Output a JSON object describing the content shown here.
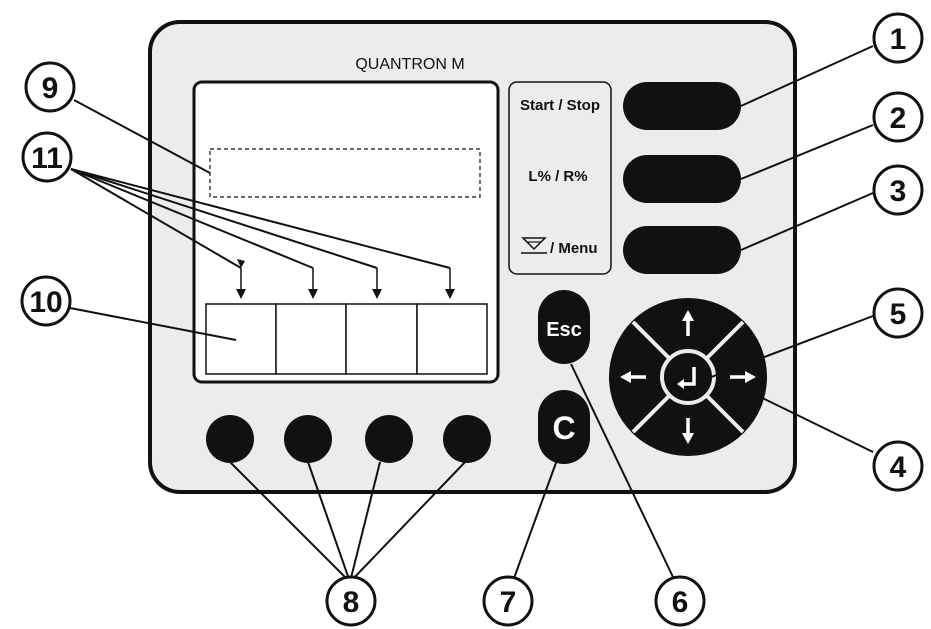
{
  "device": {
    "title": "QUANTRON M",
    "function_labels": {
      "start_stop": "Start / Stop",
      "lr_percent": "L% / R%",
      "menu": "/ Menu"
    },
    "keys": {
      "esc": "Esc",
      "clear": "C"
    },
    "icons": {
      "menu_key_icon": "hopper-icon",
      "dpad_up": "arrow-up-icon",
      "dpad_down": "arrow-down-icon",
      "dpad_left": "arrow-left-icon",
      "dpad_right": "arrow-right-icon",
      "dpad_center": "enter-icon"
    }
  },
  "callouts": {
    "c1": "1",
    "c2": "2",
    "c3": "3",
    "c4": "4",
    "c5": "5",
    "c6": "6",
    "c7": "7",
    "c8": "8",
    "c9": "9",
    "c10": "10",
    "c11": "11"
  },
  "colors": {
    "panel": "#ececec",
    "outline": "#111111",
    "key": "#111111",
    "screen": "#ffffff",
    "background": "#ffffff"
  }
}
